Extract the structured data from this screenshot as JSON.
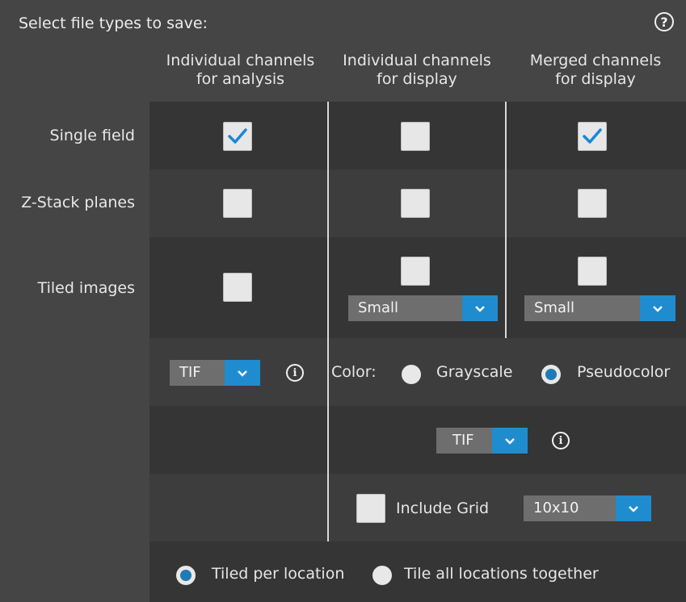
{
  "title": "Select file types to save:",
  "help_icon": "question-circle-icon",
  "columns": [
    {
      "line1": "Individual channels",
      "line2": "for analysis"
    },
    {
      "line1": "Individual channels",
      "line2": "for display"
    },
    {
      "line1": "Merged channels",
      "line2": "for display"
    }
  ],
  "rows": [
    {
      "label": "Single field",
      "checked": [
        true,
        false,
        true
      ]
    },
    {
      "label": "Z-Stack planes",
      "checked": [
        false,
        false,
        false
      ]
    },
    {
      "label": "Tiled images",
      "checked": [
        false,
        false,
        false
      ]
    }
  ],
  "tile_size": {
    "display": "Small",
    "merged": "Small"
  },
  "analysis_format": "TIF",
  "color": {
    "label": "Color:",
    "options": [
      "Grayscale",
      "Pseudocolor"
    ],
    "selected": "Pseudocolor"
  },
  "display_format": "TIF",
  "include_grid": {
    "label": "Include Grid",
    "checked": false,
    "value": "10x10"
  },
  "tiling": {
    "options": [
      "Tiled per location",
      "Tile all locations together"
    ],
    "selected": "Tiled per location"
  },
  "colors": {
    "accent": "#1f8ccf",
    "check": "#1a86d8",
    "background": "#454545"
  }
}
